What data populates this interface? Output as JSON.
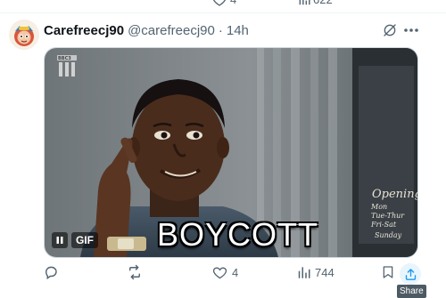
{
  "tweet": {
    "display_name": "Carefreecj90",
    "handle": "@carefreecj90",
    "separator": "·",
    "time": "14h",
    "avatar_icon": "cartoon-avatar-icon",
    "media": {
      "type": "gif",
      "badge": "GIF",
      "caption": "BOYCOTT",
      "watermark": "BBC3",
      "sign_text": [
        "Opening",
        "Mon",
        "Tue-Thur",
        "Fri-Sat",
        "Sunday"
      ]
    },
    "actions": {
      "reply_icon": "reply-icon",
      "retweet_icon": "retweet-icon",
      "like_icon": "heart-icon",
      "like_count": "4",
      "views_icon": "views-icon",
      "view_count": "744",
      "bookmark_icon": "bookmark-icon",
      "share_icon": "share-icon",
      "share_tooltip": "Share"
    }
  },
  "previous_tweet": {
    "like_count": "4",
    "view_count": "622"
  },
  "colors": {
    "text_primary": "#0f1419",
    "text_secondary": "#536471",
    "accent": "#1d9bf0",
    "share_hover_bg": "#e8f5fd",
    "tooltip_bg": "#4d5a63"
  }
}
